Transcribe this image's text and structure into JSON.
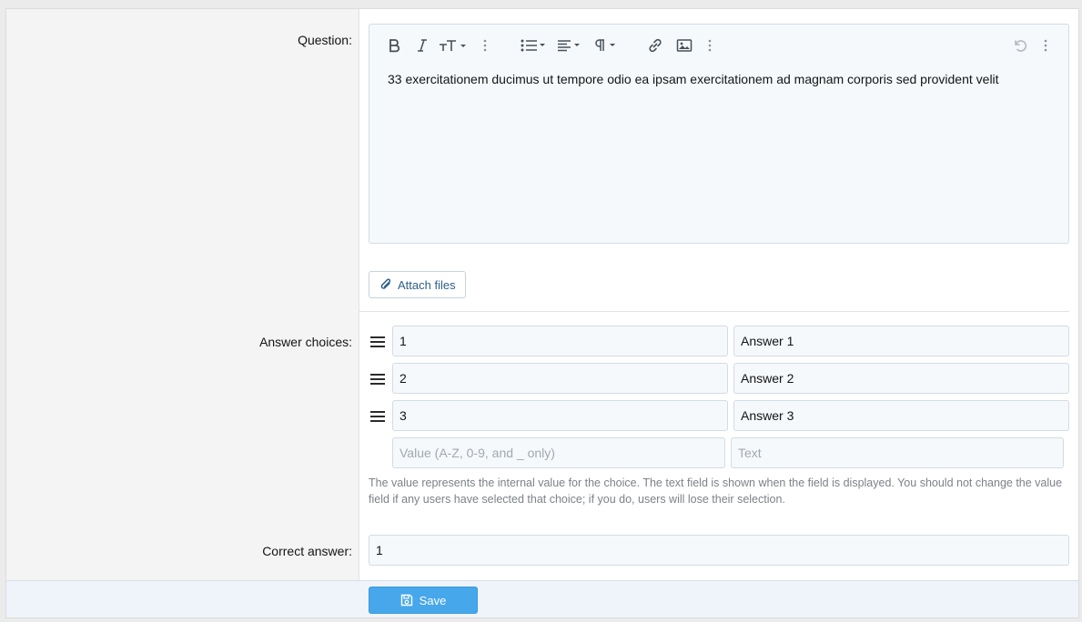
{
  "form": {
    "question_label": "Question:",
    "answer_choices_label": "Answer choices:",
    "correct_answer_label": "Correct answer:"
  },
  "editor": {
    "content": "33 exercitationem ducimus ut tempore odio ea ipsam exercitationem ad magnam corporis sed provident velit",
    "toolbar_icons": [
      "bold-icon",
      "italic-icon",
      "text-size-icon",
      "more-vertical-icon",
      "list-icon",
      "align-icon",
      "paragraph-icon",
      "more-vertical-icon",
      "link-icon",
      "image-icon",
      "more-vertical-icon",
      "undo-icon",
      "more-vertical-icon"
    ]
  },
  "attach": {
    "label": "Attach files",
    "icon": "paperclip-icon"
  },
  "choices": [
    {
      "value": "1",
      "text": "Answer 1"
    },
    {
      "value": "2",
      "text": "Answer 2"
    },
    {
      "value": "3",
      "text": "Answer 3"
    }
  ],
  "new_choice": {
    "value_placeholder": "Value (A-Z, 0-9, and _ only)",
    "text_placeholder": "Text"
  },
  "help_text": "The value represents the internal value for the choice. The text field is shown when the field is displayed. You should not change the value field if any users have selected that choice; if you do, users will lose their selection.",
  "correct_answer": {
    "value": "1"
  },
  "footer": {
    "save_label": "Save",
    "save_icon": "save-icon"
  },
  "colors": {
    "accent": "#47a7eb",
    "link": "#2f5f8a",
    "label_bg": "#f4f4f4",
    "input_bg": "#f5f9fc"
  }
}
